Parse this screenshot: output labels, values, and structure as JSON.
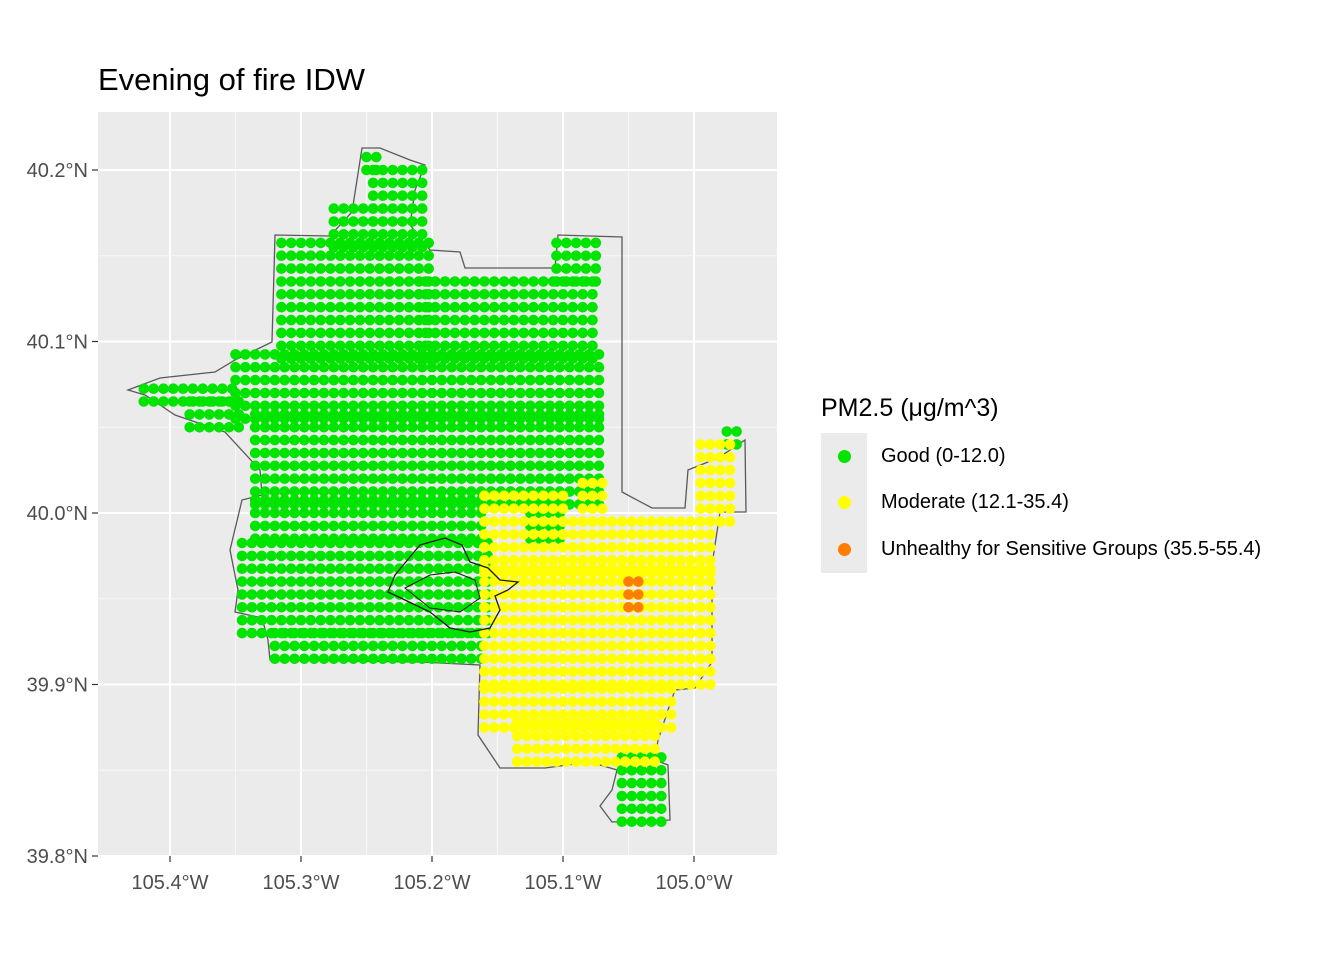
{
  "title": "Evening of fire IDW",
  "legend": {
    "title": "PM2.5 (μg/m^3)",
    "items": [
      {
        "label": "Good (0-12.0)",
        "color": "#00e400"
      },
      {
        "label": "Moderate (12.1-35.4)",
        "color": "#ffff00"
      },
      {
        "label": "Unhealthy for Sensitive Groups (35.5-55.4)",
        "color": "#ff7e00"
      }
    ]
  },
  "axes": {
    "x_ticks": [
      {
        "value": -105.4,
        "label": "105.4°W"
      },
      {
        "value": -105.3,
        "label": "105.3°W"
      },
      {
        "value": -105.2,
        "label": "105.2°W"
      },
      {
        "value": -105.1,
        "label": "105.1°W"
      },
      {
        "value": -105.0,
        "label": "105.0°W"
      }
    ],
    "y_ticks": [
      {
        "value": 40.2,
        "label": "40.2°N"
      },
      {
        "value": 40.1,
        "label": "40.1°N"
      },
      {
        "value": 40.0,
        "label": "40.0°N"
      },
      {
        "value": 39.9,
        "label": "39.9°N"
      },
      {
        "value": 39.8,
        "label": "39.8°N"
      }
    ]
  },
  "colors": {
    "panel": "#ebebeb",
    "grid": "#ffffff",
    "boundary": "#595959",
    "fire_perimeter": "#1a1a1a"
  },
  "chart_data": {
    "type": "scatter",
    "title": "Evening of fire IDW",
    "xlim": [
      -105.45,
      -104.94
    ],
    "ylim": [
      39.795,
      40.228
    ],
    "categories": [
      "Good (0-12.0)",
      "Moderate (12.1-35.4)",
      "Unhealthy for Sensitive Groups (35.5-55.4)"
    ],
    "grid_spacing_deg": 0.0075,
    "regions": [
      {
        "category": "Good (0-12.0)",
        "type": "rect",
        "x": [
          -105.315,
          -105.205
        ],
        "y": [
          40.09,
          40.155
        ]
      },
      {
        "category": "Good (0-12.0)",
        "type": "rect",
        "x": [
          -105.205,
          -105.075
        ],
        "y": [
          40.09,
          40.135
        ]
      },
      {
        "category": "Good (0-12.0)",
        "type": "rect",
        "x": [
          -105.105,
          -105.075
        ],
        "y": [
          40.135,
          40.16
        ]
      },
      {
        "category": "Good (0-12.0)",
        "type": "rect",
        "x": [
          -105.245,
          -105.21
        ],
        "y": [
          40.155,
          40.2
        ]
      },
      {
        "category": "Good (0-12.0)",
        "type": "rect",
        "x": [
          -105.25,
          -105.24
        ],
        "y": [
          40.2,
          40.21
        ]
      },
      {
        "category": "Good (0-12.0)",
        "type": "rect",
        "x": [
          -105.275,
          -105.245
        ],
        "y": [
          40.155,
          40.18
        ]
      },
      {
        "category": "Good (0-12.0)",
        "type": "rect",
        "x": [
          -105.35,
          -105.075
        ],
        "y": [
          40.055,
          40.09
        ]
      },
      {
        "category": "Good (0-12.0)",
        "type": "rect",
        "x": [
          -105.42,
          -105.35
        ],
        "y": [
          40.065,
          40.075
        ]
      },
      {
        "category": "Good (0-12.0)",
        "type": "rect",
        "x": [
          -105.385,
          -105.35
        ],
        "y": [
          40.05,
          40.065
        ]
      },
      {
        "category": "Good (0-12.0)",
        "type": "rect",
        "x": [
          -105.335,
          -105.075
        ],
        "y": [
          40.005,
          40.055
        ]
      },
      {
        "category": "Good (0-12.0)",
        "type": "rect",
        "x": [
          -105.335,
          -105.16
        ],
        "y": [
          39.985,
          40.005
        ]
      },
      {
        "category": "Good (0-12.0)",
        "type": "rect",
        "x": [
          -105.125,
          -105.1
        ],
        "y": [
          39.985,
          40.005
        ]
      },
      {
        "category": "Good (0-12.0)",
        "type": "rect",
        "x": [
          -105.345,
          -105.16
        ],
        "y": [
          39.93,
          39.985
        ]
      },
      {
        "category": "Good (0-12.0)",
        "type": "rect",
        "x": [
          -105.32,
          -105.16
        ],
        "y": [
          39.915,
          39.93
        ]
      },
      {
        "category": "Good (0-12.0)",
        "type": "rect",
        "x": [
          -104.975,
          -104.965
        ],
        "y": [
          40.04,
          40.045
        ]
      },
      {
        "category": "Good (0-12.0)",
        "type": "rect",
        "x": [
          -105.055,
          -105.025
        ],
        "y": [
          39.82,
          39.855
        ]
      },
      {
        "category": "Moderate (12.1-35.4)",
        "type": "rect",
        "x": [
          -105.16,
          -105.1
        ],
        "y": [
          39.965,
          40.01
        ]
      },
      {
        "category": "Moderate (12.1-35.4)",
        "type": "rect",
        "x": [
          -105.1,
          -104.99
        ],
        "y": [
          39.965,
          39.995
        ]
      },
      {
        "category": "Moderate (12.1-35.4)",
        "type": "rect",
        "x": [
          -105.085,
          -105.07
        ],
        "y": [
          39.995,
          40.015
        ]
      },
      {
        "category": "Moderate (12.1-35.4)",
        "type": "rect",
        "x": [
          -105.16,
          -104.99
        ],
        "y": [
          39.9,
          39.965
        ]
      },
      {
        "category": "Moderate (12.1-35.4)",
        "type": "rect",
        "x": [
          -105.16,
          -105.02
        ],
        "y": [
          39.875,
          39.9
        ]
      },
      {
        "category": "Moderate (12.1-35.4)",
        "type": "rect",
        "x": [
          -105.135,
          -105.03
        ],
        "y": [
          39.855,
          39.875
        ]
      },
      {
        "category": "Moderate (12.1-35.4)",
        "type": "rect",
        "x": [
          -104.995,
          -104.97
        ],
        "y": [
          39.995,
          40.04
        ]
      },
      {
        "category": "Unhealthy for Sensitive Groups (35.5-55.4)",
        "type": "rect",
        "x": [
          -105.05,
          -105.04
        ],
        "y": [
          39.945,
          39.96
        ]
      }
    ]
  }
}
